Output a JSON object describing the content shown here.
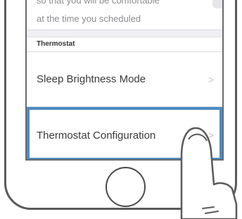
{
  "top_cell": {
    "line1": "so that you will be comfortable",
    "line2": "at the time you scheduled"
  },
  "section": {
    "header": "Thermostat"
  },
  "rows": [
    {
      "label": "Sleep Brightness Mode",
      "chevron": ">"
    },
    {
      "label": "Thermostat Configuration",
      "chevron": ">"
    }
  ],
  "highlight_color": "#4a8cc6",
  "icons": {
    "pointing_hand": "pointing-hand-icon",
    "home_button": "home-button"
  }
}
